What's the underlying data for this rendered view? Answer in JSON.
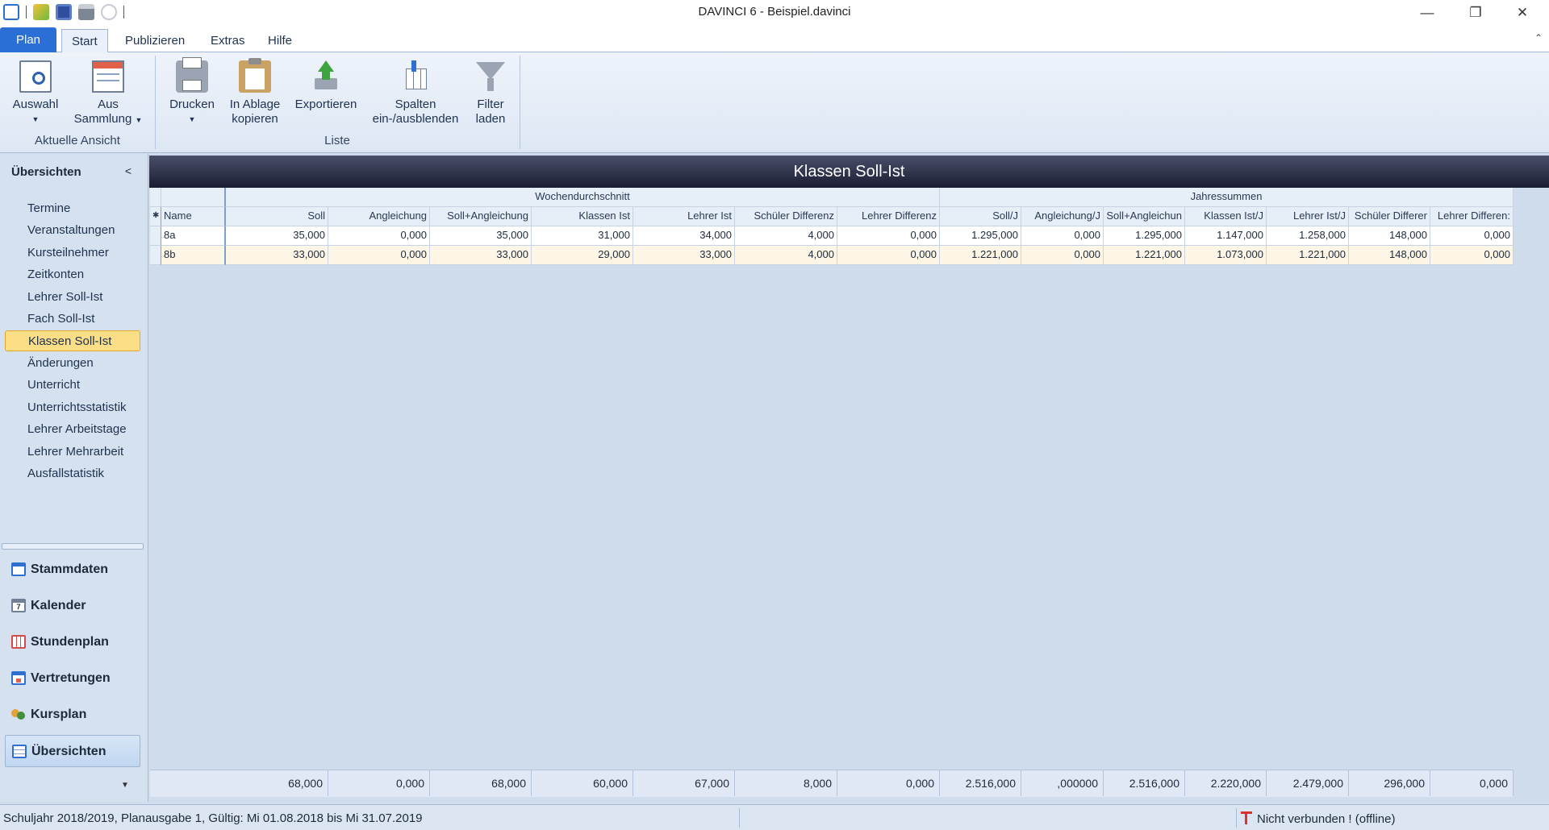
{
  "window": {
    "title": "DAVINCI 6 - Beispiel.davinci",
    "minimize": "—",
    "maximize": "❐",
    "close": "✕"
  },
  "ribbon_tabs": [
    "Plan",
    "Start",
    "Publizieren",
    "Extras",
    "Hilfe"
  ],
  "ribbon": {
    "auswahl": "Auswahl",
    "aus_line1": "Aus",
    "aus_line2": "Sammlung",
    "group_aktuelle_ansicht": "Aktuelle Ansicht",
    "drucken": "Drucken",
    "ablage_line1": "In Ablage",
    "ablage_line2": "kopieren",
    "exportieren": "Exportieren",
    "spalten_line1": "Spalten",
    "spalten_line2": "ein-/ausblenden",
    "filter_line1": "Filter",
    "filter_line2": "laden",
    "group_liste": "Liste"
  },
  "sidebar": {
    "header": "Übersichten",
    "items": [
      "Termine",
      "Veranstaltungen",
      "Kursteilnehmer",
      "Zeitkonten",
      "Lehrer Soll-Ist",
      "Fach Soll-Ist",
      "Klassen Soll-Ist",
      "Änderungen",
      "Unterricht",
      "Unterrichtsstatistik",
      "Lehrer Arbeitstage",
      "Lehrer Mehrarbeit",
      "Ausfallstatistik"
    ],
    "selected_item": "Klassen Soll-Ist",
    "modules": [
      "Stammdaten",
      "Kalender",
      "Stundenplan",
      "Vertretungen",
      "Kursplan",
      "Übersichten"
    ],
    "selected_module": "Übersichten"
  },
  "content": {
    "title": "Klassen Soll-Ist",
    "band_week": "Wochendurchschnitt",
    "band_year": "Jahressummen",
    "columns": [
      "Name",
      "Soll",
      "Angleichung",
      "Soll+Angleichung",
      "Klassen Ist",
      "Lehrer Ist",
      "Schüler Differenz",
      "Lehrer Differenz",
      "Soll/J",
      "Angleichung/J",
      "Soll+Angleichun",
      "Klassen Ist/J",
      "Lehrer Ist/J",
      "Schüler Differer",
      "Lehrer Differen:"
    ],
    "rows": [
      [
        "8a",
        "35,000",
        "0,000",
        "35,000",
        "31,000",
        "34,000",
        "4,000",
        "0,000",
        "1.295,000",
        "0,000",
        "1.295,000",
        "1.147,000",
        "1.258,000",
        "148,000",
        "0,000"
      ],
      [
        "8b",
        "33,000",
        "0,000",
        "33,000",
        "29,000",
        "33,000",
        "4,000",
        "0,000",
        "1.221,000",
        "0,000",
        "1.221,000",
        "1.073,000",
        "1.221,000",
        "148,000",
        "0,000"
      ]
    ],
    "totals": [
      "68,000",
      "0,000",
      "68,000",
      "60,000",
      "67,000",
      "8,000",
      "0,000",
      "2.516,000",
      ",000000",
      "2.516,000",
      "2.220,000",
      "2.479,000",
      "296,000",
      "0,000"
    ]
  },
  "status": {
    "text": "Schuljahr 2018/2019, Planausgabe 1, Gültig: Mi 01.08.2018 bis Mi 31.07.2019",
    "connection": "Nicht verbunden ! (offline)"
  },
  "colors": {
    "plan_tab": "#2a6ed6",
    "header_dark": "#1a1d33",
    "selected_nav": "#fbde85",
    "connection_icon": "#d9342b"
  }
}
